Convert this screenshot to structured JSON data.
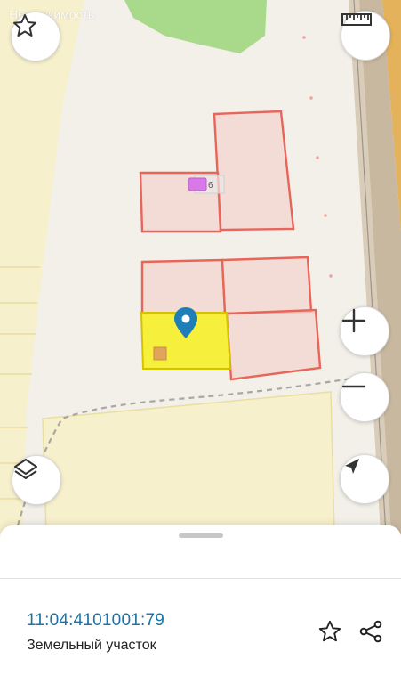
{
  "map": {
    "watermark_text": "Недвижимость",
    "colors": {
      "background": "#f3efe9",
      "field": "#f7f0cc",
      "field_line": "#eadfa0",
      "forest": "#a9d98a",
      "road": "#b8b0a6",
      "parcel_outline": "#e8655a",
      "parcel_fill": "#f3d6cf",
      "selected_parcel_fill": "#f6ef2a",
      "selected_parcel_outline": "#d4c400",
      "marker": "#1e7fb8",
      "building_badge": "#d879e8"
    },
    "building_badge_label": "6",
    "buttons": {
      "favorite": "star-icon",
      "ruler": "ruler-icon",
      "zoom_in": "plus-icon",
      "zoom_out": "minus-icon",
      "layers": "layers-icon",
      "locate": "navigation-arrow-icon"
    }
  },
  "sheet": {
    "cadastral_number": "11:04:4101001:79",
    "parcel_type": "Земельный участок",
    "actions": {
      "favorite": "star-outline-icon",
      "share": "share-icon"
    }
  }
}
